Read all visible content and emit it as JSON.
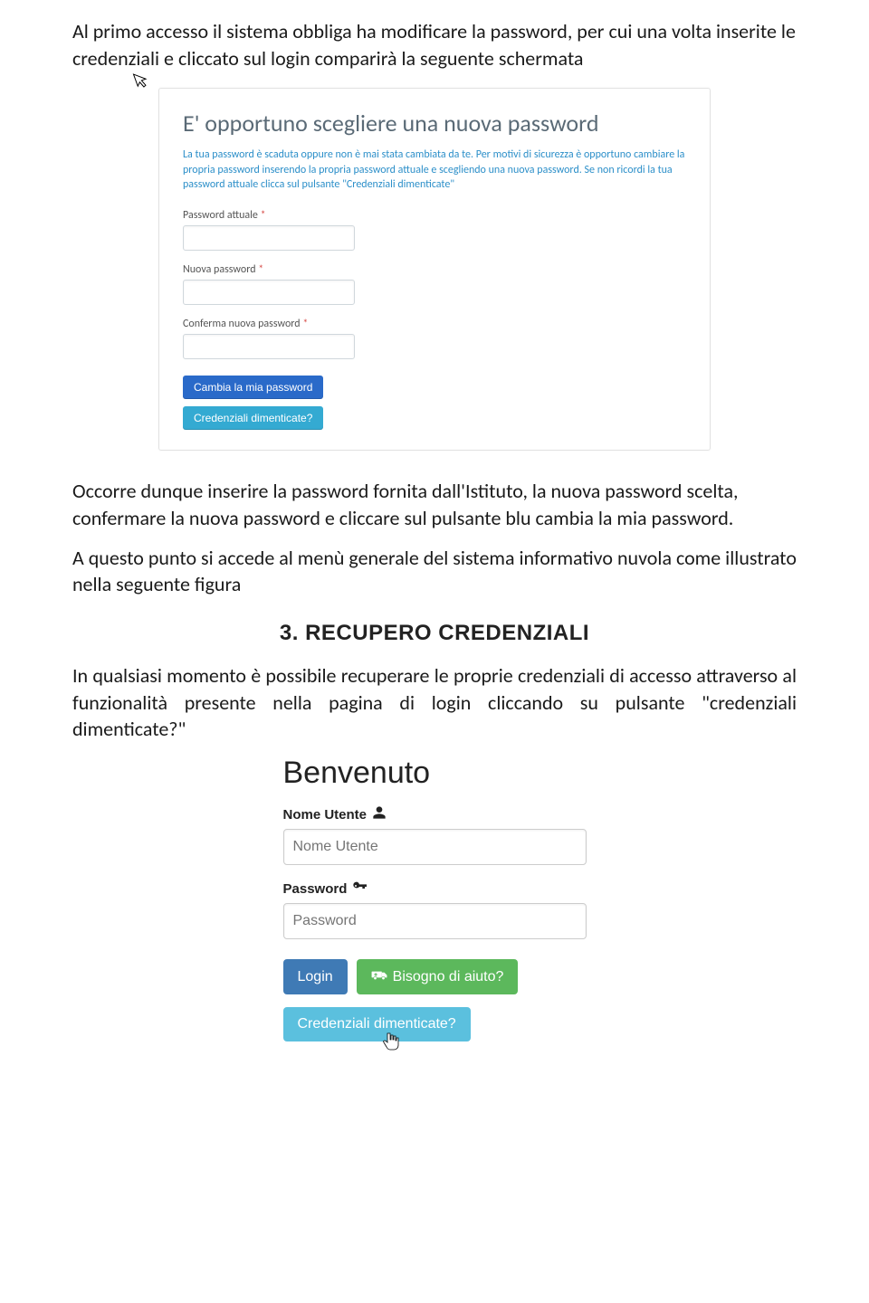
{
  "doc": {
    "p1": "Al primo accesso il sistema obbliga ha modificare la password, per cui una volta inserite le credenziali e cliccato sul login comparirà la seguente schermata",
    "p2": "Occorre dunque inserire la password fornita dall'Istituto, la nuova password scelta, confermare la nuova password e cliccare sul pulsante blu cambia la mia password.",
    "p3": "A questo punto si accede al menù generale del sistema informativo nuvola come illustrato nella seguente figura",
    "heading": "3. RECUPERO CREDENZIALI",
    "p4": "In qualsiasi momento è possibile recuperare le proprie credenziali di accesso attraverso al funzionalità presente nella pagina di login cliccando su pulsante \"credenziali dimenticate?\""
  },
  "panel": {
    "title": "E' opportuno scegliere una nuova password",
    "help": "La tua password è scaduta oppure non è mai stata cambiata da te. Per motivi di sicurezza è opportuno cambiare la propria password inserendo la propria password attuale e scegliendo una nuova password. Se non ricordi la tua password attuale clicca sul pulsante \"Credenziali dimenticate\"",
    "field1_label": "Password attuale",
    "field2_label": "Nuova password",
    "field3_label": "Conferma nuova password",
    "required_mark": "*",
    "btn_change": "Cambia la mia password",
    "btn_forgot": "Credenziali dimenticate?"
  },
  "login": {
    "title": "Benvenuto",
    "user_label": "Nome Utente",
    "user_placeholder": "Nome Utente",
    "pass_label": "Password",
    "pass_placeholder": "Password",
    "btn_login": "Login",
    "btn_help": "Bisogno di aiuto?",
    "btn_forgot": "Credenziali dimenticate?"
  },
  "icons": {
    "cursor_glyph": "↖",
    "hand_glyph": "☟"
  }
}
